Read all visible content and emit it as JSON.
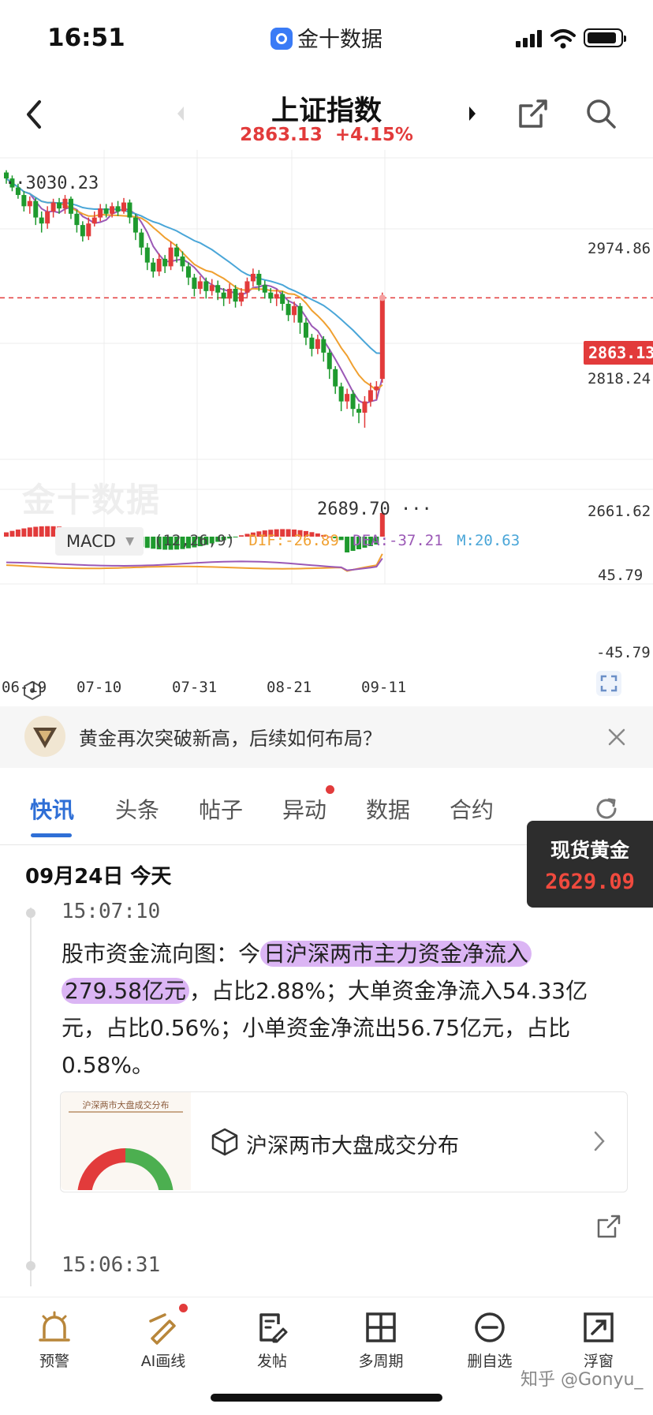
{
  "status": {
    "time": "16:51",
    "app_name": "金十数据"
  },
  "header": {
    "title": "上证指数",
    "price": "2863.13",
    "change": "+4.15%"
  },
  "chart_data": {
    "type": "candlestick",
    "y_labels": [
      "2974.86",
      "2818.24",
      "2661.62"
    ],
    "current_price_tag": "2863.13",
    "annotations": {
      "high": "3030.23",
      "low": "2689.70"
    },
    "x_labels": [
      "06-19",
      "07-10",
      "07-31",
      "08-21",
      "09-11"
    ],
    "ylim": [
      2650,
      3060
    ],
    "candles": [
      [
        3030,
        3022,
        3033,
        3015
      ],
      [
        3022,
        3010,
        3026,
        3005
      ],
      [
        3010,
        3000,
        3015,
        2995
      ],
      [
        3000,
        2985,
        3005,
        2978
      ],
      [
        2985,
        2992,
        2998,
        2975
      ],
      [
        2992,
        2970,
        2996,
        2960
      ],
      [
        2970,
        2962,
        2978,
        2950
      ],
      [
        2962,
        2978,
        2985,
        2955
      ],
      [
        2978,
        2990,
        2995,
        2970
      ],
      [
        2990,
        2982,
        2996,
        2975
      ],
      [
        2982,
        2995,
        3000,
        2975
      ],
      [
        2995,
        2975,
        2998,
        2968
      ],
      [
        2975,
        2960,
        2980,
        2950
      ],
      [
        2960,
        2945,
        2965,
        2938
      ],
      [
        2945,
        2962,
        2970,
        2940
      ],
      [
        2962,
        2970,
        2978,
        2958
      ],
      [
        2970,
        2982,
        2988,
        2965
      ],
      [
        2982,
        2975,
        2988,
        2970
      ],
      [
        2975,
        2985,
        2990,
        2970
      ],
      [
        2985,
        2978,
        2992,
        2972
      ],
      [
        2978,
        2990,
        2996,
        2975
      ],
      [
        2990,
        2970,
        2994,
        2962
      ],
      [
        2970,
        2950,
        2975,
        2940
      ],
      [
        2950,
        2930,
        2955,
        2920
      ],
      [
        2930,
        2910,
        2936,
        2900
      ],
      [
        2910,
        2898,
        2916,
        2890
      ],
      [
        2898,
        2915,
        2922,
        2892
      ],
      [
        2915,
        2905,
        2920,
        2896
      ],
      [
        2905,
        2930,
        2938,
        2900
      ],
      [
        2930,
        2918,
        2935,
        2910
      ],
      [
        2918,
        2905,
        2925,
        2898
      ],
      [
        2905,
        2890,
        2910,
        2880
      ],
      [
        2890,
        2875,
        2895,
        2865
      ],
      [
        2875,
        2885,
        2892,
        2868
      ],
      [
        2885,
        2872,
        2890,
        2862
      ],
      [
        2872,
        2880,
        2888,
        2866
      ],
      [
        2880,
        2870,
        2886,
        2860
      ],
      [
        2870,
        2862,
        2876,
        2852
      ],
      [
        2862,
        2875,
        2882,
        2855
      ],
      [
        2875,
        2858,
        2880,
        2850
      ],
      [
        2858,
        2870,
        2876,
        2852
      ],
      [
        2870,
        2885,
        2890,
        2864
      ],
      [
        2885,
        2895,
        2902,
        2878
      ],
      [
        2895,
        2880,
        2900,
        2872
      ],
      [
        2880,
        2870,
        2886,
        2862
      ],
      [
        2870,
        2862,
        2876,
        2856
      ],
      [
        2862,
        2868,
        2874,
        2852
      ],
      [
        2868,
        2855,
        2872,
        2846
      ],
      [
        2855,
        2840,
        2860,
        2832
      ],
      [
        2840,
        2852,
        2858,
        2830
      ],
      [
        2852,
        2830,
        2856,
        2815
      ],
      [
        2830,
        2810,
        2836,
        2800
      ],
      [
        2810,
        2795,
        2815,
        2785
      ],
      [
        2795,
        2808,
        2814,
        2788
      ],
      [
        2808,
        2790,
        2812,
        2778
      ],
      [
        2790,
        2768,
        2795,
        2755
      ],
      [
        2768,
        2745,
        2772,
        2735
      ],
      [
        2745,
        2725,
        2750,
        2712
      ],
      [
        2725,
        2735,
        2742,
        2715
      ],
      [
        2735,
        2715,
        2740,
        2705
      ],
      [
        2715,
        2710,
        2722,
        2696
      ],
      [
        2710,
        2725,
        2732,
        2690
      ],
      [
        2725,
        2740,
        2750,
        2718
      ],
      [
        2740,
        2745,
        2752,
        2728
      ],
      [
        2755,
        2863,
        2870,
        2750
      ]
    ]
  },
  "macd": {
    "label": "MACD",
    "params": "(12,26,9)",
    "dif": "DIF:-26.89",
    "dea": "DEA:-37.21",
    "m": "M:20.63",
    "y_top": "45.79",
    "y_bottom": "-45.79"
  },
  "banner": {
    "text": "黄金再次突破新高，后续如何布局？"
  },
  "tabs": [
    {
      "label": "快讯"
    },
    {
      "label": "头条"
    },
    {
      "label": "帖子"
    },
    {
      "label": "异动"
    },
    {
      "label": "数据"
    },
    {
      "label": "合约"
    }
  ],
  "gold": {
    "label": "现货黄金",
    "price": "2629.09"
  },
  "feed": {
    "date": "09月24日 今天",
    "items": [
      {
        "time": "15:07:10",
        "text_a": "股市资金流向图：今",
        "text_hl1": "日沪深两市主力资金净流入",
        "text_hl2": "279.58亿元",
        "text_b": "，占比2.88%；大单资金净流入54.33亿元，占比0.56%；小单资金净流出56.75亿元，占比0.58%。",
        "card_title": "沪深两市大盘成交分布",
        "thumb_title": "沪深两市大盘成交分布"
      },
      {
        "time": "15:06:31"
      }
    ]
  },
  "bottom_nav": [
    {
      "label": "预警",
      "icon": "alarm-icon"
    },
    {
      "label": "AI画线",
      "icon": "ai-draw-icon"
    },
    {
      "label": "发帖",
      "icon": "post-icon"
    },
    {
      "label": "多周期",
      "icon": "multi-period-icon"
    },
    {
      "label": "删自选",
      "icon": "remove-watchlist-icon"
    },
    {
      "label": "浮窗",
      "icon": "float-window-icon"
    }
  ],
  "watermark": "知乎 @Gonyu_",
  "colors": {
    "up": "#e23b3b",
    "down": "#1e9a2e",
    "accent": "#2f6fd6"
  }
}
